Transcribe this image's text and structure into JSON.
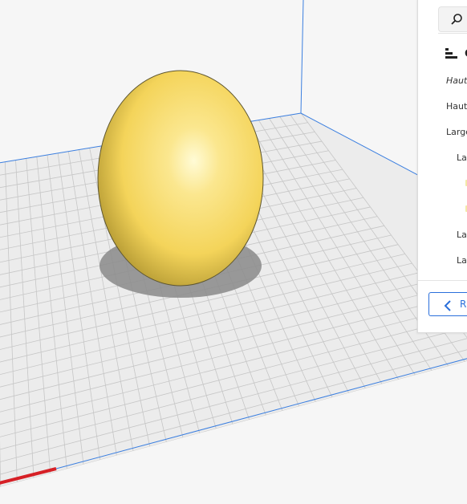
{
  "viewport": {
    "model_name": "egg-model",
    "bed_color": "#ececec",
    "grid_color": "#c9c9c9",
    "model_color": "#f7dd5f",
    "shadow_color": "#7a7a7a",
    "x_axis_color": "#d62026",
    "build_volume_color": "#3b7fe0"
  },
  "panel": {
    "search_icon": "search-icon",
    "header_icon": "settings-list-icon",
    "header_label": "C",
    "settings": [
      {
        "label": "Haute",
        "style": "italic"
      },
      {
        "label": "Haute",
        "style": "normal"
      },
      {
        "label": "Large",
        "style": "normal"
      },
      {
        "label": "Lar",
        "style": "normal"
      },
      {
        "label": "Lar",
        "style": "normal"
      },
      {
        "label": "Lar",
        "style": "normal"
      }
    ],
    "recommended_button": {
      "label": "R",
      "icon": "chevron-left-icon"
    }
  }
}
